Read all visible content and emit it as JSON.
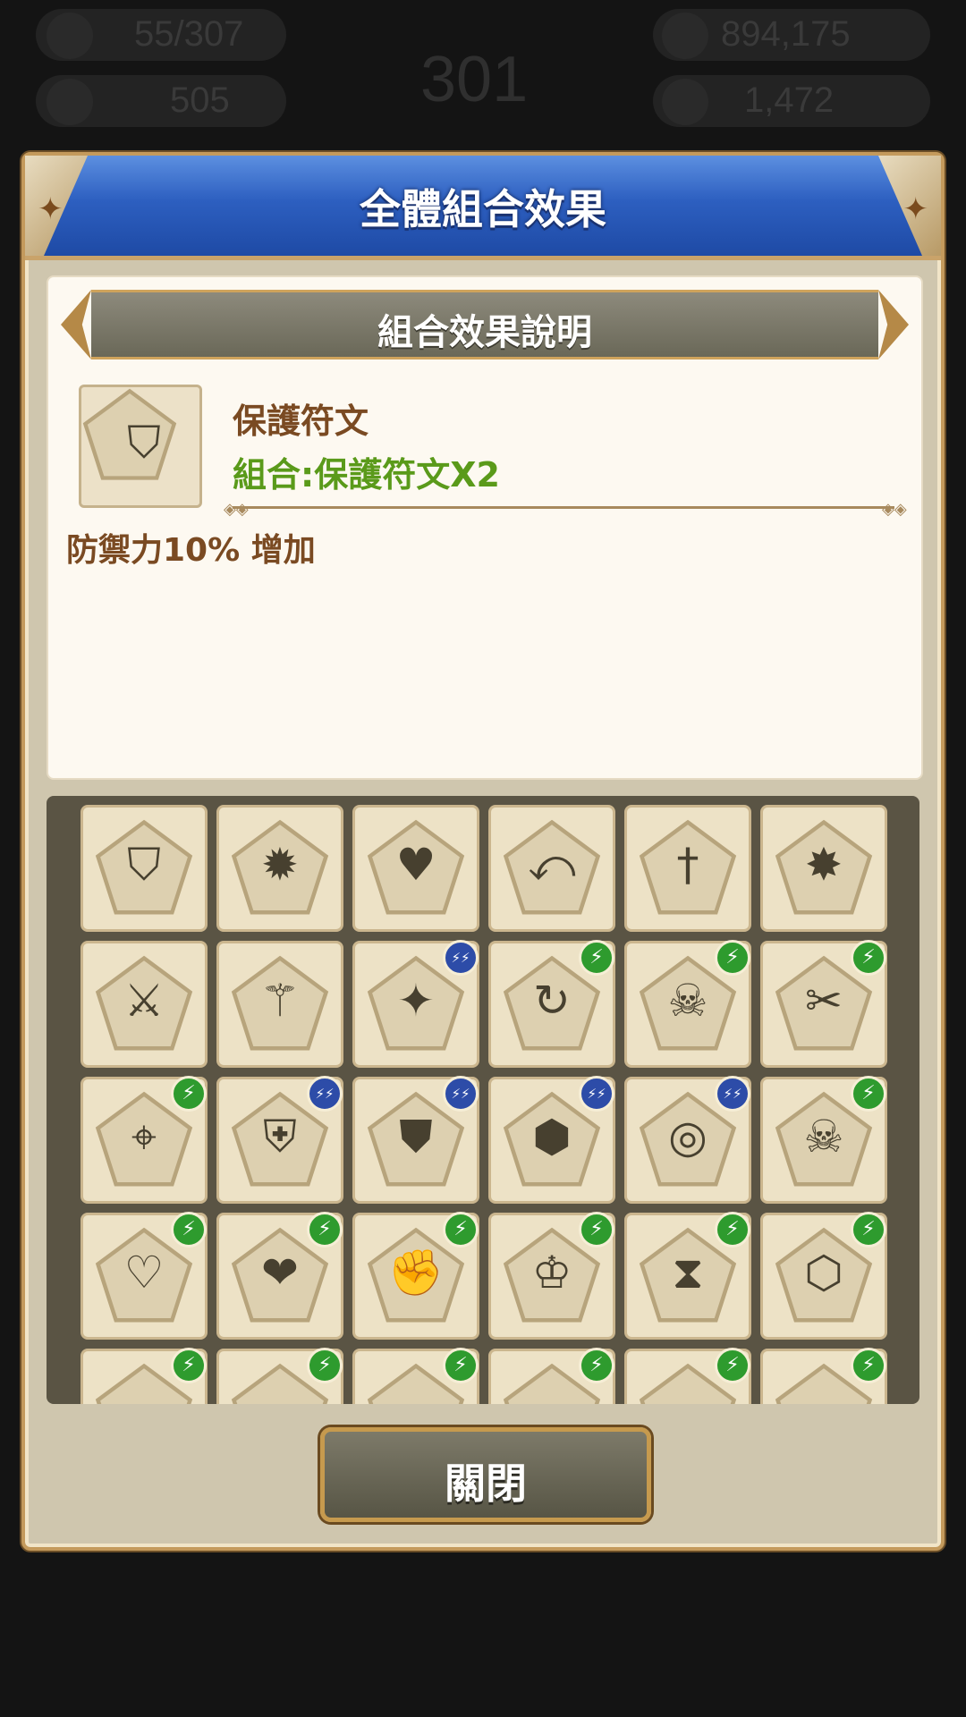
{
  "hud": {
    "stamina": "55/307",
    "gems": "505",
    "level": "301",
    "gold": "894,175",
    "other": "1,472"
  },
  "dialog": {
    "title": "全體組合效果",
    "section_title": "組合效果說明",
    "selected": {
      "icon": "shield-icon",
      "name": "保護符文",
      "combo": "組合:保護符文X2",
      "description": "防禦力10% 增加"
    },
    "close_label": "關閉"
  },
  "colors": {
    "title_blue": "#2d5fc0",
    "combo_green": "#5a9a1a",
    "text_brown": "#7a4a22",
    "badge_green": "#2e9b2e",
    "badge_blue": "#2d4ca8"
  },
  "runes": [
    {
      "icon": "shield-icon",
      "glyph": "⛉",
      "badge": ""
    },
    {
      "icon": "burst-icon",
      "glyph": "✹",
      "badge": ""
    },
    {
      "icon": "heart-icon",
      "glyph": "♥",
      "badge": ""
    },
    {
      "icon": "hook-icon",
      "glyph": "⤺",
      "badge": ""
    },
    {
      "icon": "sword-icon",
      "glyph": "†",
      "badge": ""
    },
    {
      "icon": "sword-burst-icon",
      "glyph": "✸",
      "badge": ""
    },
    {
      "icon": "crossed-swords-icon",
      "glyph": "⚔",
      "badge": ""
    },
    {
      "icon": "serrated-blade-icon",
      "glyph": "⚚",
      "badge": ""
    },
    {
      "icon": "sparkles-icon",
      "glyph": "✦",
      "badge": "blue"
    },
    {
      "icon": "sword-cycle-icon",
      "glyph": "↻",
      "badge": "green"
    },
    {
      "icon": "skull-cycle-icon",
      "glyph": "☠",
      "badge": "green"
    },
    {
      "icon": "blood-blade-icon",
      "glyph": "✂",
      "badge": "green"
    },
    {
      "icon": "crosshair-icon",
      "glyph": "⌖",
      "badge": "green"
    },
    {
      "icon": "sword-shield-icon",
      "glyph": "⛨",
      "badge": "blue"
    },
    {
      "icon": "burst-shield-icon",
      "glyph": "⛊",
      "badge": "blue"
    },
    {
      "icon": "drop-hexagon-icon",
      "glyph": "⬢",
      "badge": "blue"
    },
    {
      "icon": "concentric-hexagon-icon",
      "glyph": "◎",
      "badge": "blue"
    },
    {
      "icon": "skull-icon",
      "glyph": "☠",
      "badge": "green"
    },
    {
      "icon": "broken-heart-halo-icon",
      "glyph": "♡",
      "badge": "green"
    },
    {
      "icon": "double-heart-icon",
      "glyph": "❤",
      "badge": "green"
    },
    {
      "icon": "fist-icon",
      "glyph": "✊",
      "badge": "green"
    },
    {
      "icon": "crown-head-icon",
      "glyph": "♔",
      "badge": "green"
    },
    {
      "icon": "hourglass-cycle-icon",
      "glyph": "⧗",
      "badge": "green"
    },
    {
      "icon": "honeycomb-icon",
      "glyph": "⬡",
      "badge": "green"
    },
    {
      "icon": "rune-icon",
      "glyph": "",
      "badge": "green"
    },
    {
      "icon": "rune-icon",
      "glyph": "",
      "badge": "green"
    },
    {
      "icon": "rune-icon",
      "glyph": "",
      "badge": "green"
    },
    {
      "icon": "rune-icon",
      "glyph": "",
      "badge": "green"
    },
    {
      "icon": "rune-icon",
      "glyph": "",
      "badge": "green"
    },
    {
      "icon": "rune-icon",
      "glyph": "",
      "badge": "green"
    }
  ],
  "badge_symbols": {
    "green": "⚡",
    "blue": "⚡⚡"
  }
}
